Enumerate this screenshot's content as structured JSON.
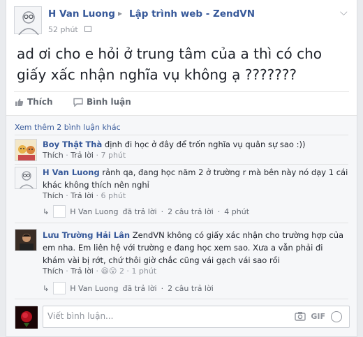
{
  "post": {
    "author": "H Van Luong",
    "arrow": "▸",
    "group": "Lập trình web - ZendVN",
    "time": "52 phút",
    "text": "ad ơi cho e hỏi ở trung tâm của a thì có cho giấy xấc nhận nghĩa vụ không ạ ???????"
  },
  "actions": {
    "like": "Thích",
    "comment": "Bình luận"
  },
  "more_comments": "Xem thêm 2 bình luận khác",
  "comments": [
    {
      "name": "Boy Thật Thà",
      "text": "định đi học ở đây để trốn nghĩa vụ quân sự sao :))",
      "like": "Thích",
      "reply": "Trả lời",
      "time": "7 phút"
    },
    {
      "name": "H Van Luong",
      "text": "rảnh qa, đang học năm 2 ở trường r mà bên này nó dạy 1 cái khác không thích nên nghỉ",
      "like": "Thích",
      "reply": "Trả lời",
      "time": "6 phút"
    },
    {
      "name": "Lưu Trường Hải Lân",
      "text": "ZendVN không có giấy xác nhận cho trường hợp của em nha. Em liên hệ với trường e đang học xem sao. Xưa a vẫn phải đi khám vài bị rớt, chứ thôi giờ chắc cũng vái gạch vái sao rồi",
      "like": "Thích",
      "reply": "Trả lời",
      "reactions": "2",
      "time": "1 phút"
    }
  ],
  "reply_summaries": [
    {
      "name": "H Van Luong",
      "text": "đã trả lời",
      "count": "2 câu trả lời",
      "time": "4 phút"
    },
    {
      "name": "H Van Luong",
      "text": "đã trả lời",
      "count": "2 câu trả lời"
    }
  ],
  "composer": {
    "placeholder": "Viết bình luận...",
    "gif": "GIF"
  },
  "colors": {
    "link": "#365899",
    "meta": "#90949c",
    "background": "#f6f7f9"
  }
}
